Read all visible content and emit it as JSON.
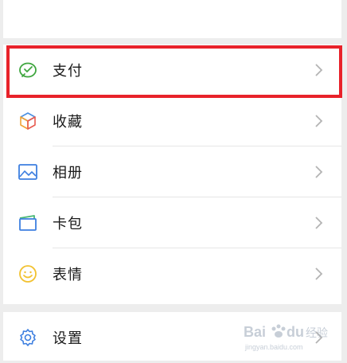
{
  "menu": {
    "items": [
      {
        "label": "支付",
        "icon": "wechat-pay-icon"
      },
      {
        "label": "收藏",
        "icon": "favorites-cube-icon"
      },
      {
        "label": "相册",
        "icon": "album-picture-icon"
      },
      {
        "label": "卡包",
        "icon": "card-wallet-icon"
      },
      {
        "label": "表情",
        "icon": "sticker-smile-icon"
      }
    ],
    "settings": {
      "label": "设置",
      "icon": "gear-icon"
    }
  },
  "watermark": {
    "line1": "Bai",
    "line2": "du",
    "line3": "经验",
    "url": "jingyan.baidu.com"
  },
  "colors": {
    "highlight": "#e8222a",
    "pay_green": "#3fa63f",
    "cube_blue": "#4a90e2",
    "cube_orange": "#f0a336",
    "cube_red": "#e85a4f",
    "album_blue": "#3d7fe0",
    "card_blue": "#3d7fe0",
    "card_green": "#48b774",
    "smile_yellow": "#f2c231",
    "gear_blue": "#3d7fe0"
  }
}
